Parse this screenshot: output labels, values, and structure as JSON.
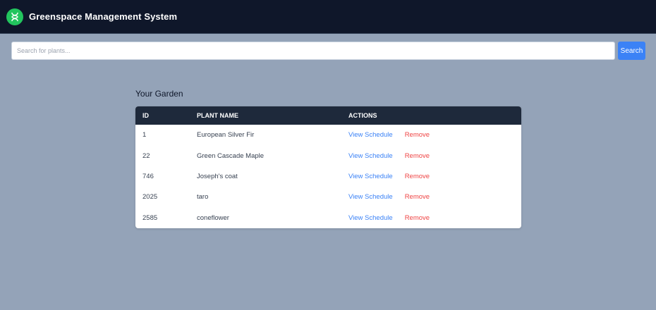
{
  "header": {
    "title": "Greenspace Management System",
    "logo_icon": "leaf-dna-icon",
    "bg_color": "#0f172a",
    "logo_color": "#22c55e"
  },
  "search": {
    "placeholder": "Search for plants...",
    "value": "",
    "button_label": "Search"
  },
  "garden": {
    "title": "Your Garden",
    "columns": [
      "ID",
      "PLANT NAME",
      "ACTIONS"
    ],
    "rows": [
      {
        "id": "1",
        "name": "European Silver Fir",
        "schedule_label": "View Schedule",
        "remove_label": "Remove"
      },
      {
        "id": "22",
        "name": "Green Cascade Maple",
        "schedule_label": "View Schedule",
        "remove_label": "Remove"
      },
      {
        "id": "746",
        "name": "Joseph's coat",
        "schedule_label": "View Schedule",
        "remove_label": "Remove"
      },
      {
        "id": "2025",
        "name": "taro",
        "schedule_label": "View Schedule",
        "remove_label": "Remove"
      },
      {
        "id": "2585",
        "name": "coneflower",
        "schedule_label": "View Schedule",
        "remove_label": "Remove"
      }
    ]
  }
}
